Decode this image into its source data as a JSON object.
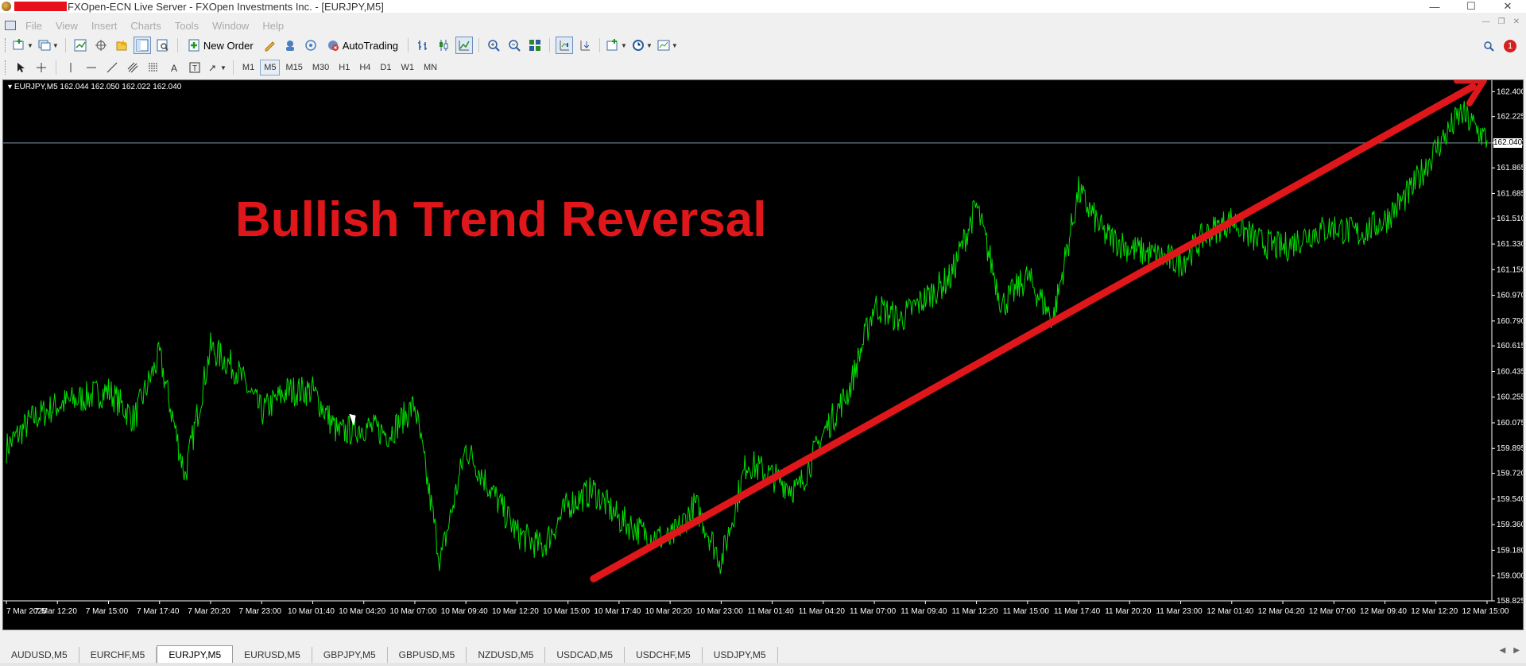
{
  "window": {
    "title": "FXOpen-ECN Live Server - FXOpen Investments Inc. - [EURJPY,M5]",
    "controls": {
      "minimize": "—",
      "maximize": "☐",
      "close": "✕"
    }
  },
  "menu": {
    "items": [
      "File",
      "View",
      "Insert",
      "Charts",
      "Tools",
      "Window",
      "Help"
    ],
    "mdi_controls": [
      "—",
      "❐",
      "✕"
    ]
  },
  "toolbar": {
    "new_order_label": "New Order",
    "autotrading_label": "AutoTrading",
    "notification_count": "1"
  },
  "timeframes": {
    "items": [
      "M1",
      "M5",
      "M15",
      "M30",
      "H1",
      "H4",
      "D1",
      "W1",
      "MN"
    ],
    "active": "M5"
  },
  "chart": {
    "symbol_info": "EURJPY,M5  162.044 162.050 162.022 162.040",
    "annotation_text": "Bullish Trend Reversal",
    "current_price_label": "162.040",
    "line_color": "#00e000",
    "arrow_color": "#e0171a",
    "annotation_color": "#e0171a",
    "background_color": "#000000"
  },
  "chart_data": {
    "type": "line",
    "title": "EURJPY,M5",
    "xlabel": "",
    "ylabel": "",
    "ylim": [
      158.825,
      162.48
    ],
    "y_ticks": [
      "162.400",
      "162.225",
      "162.040",
      "161.865",
      "161.685",
      "161.510",
      "161.330",
      "161.150",
      "160.970",
      "160.790",
      "160.615",
      "160.435",
      "160.255",
      "160.075",
      "159.895",
      "159.720",
      "159.540",
      "159.360",
      "159.180",
      "159.000",
      "158.825"
    ],
    "x_ticks": [
      "7 Mar 2025",
      "7 Mar 12:20",
      "7 Mar 15:00",
      "7 Mar 17:40",
      "7 Mar 20:20",
      "7 Mar 23:00",
      "10 Mar 01:40",
      "10 Mar 04:20",
      "10 Mar 07:00",
      "10 Mar 09:40",
      "10 Mar 12:20",
      "10 Mar 15:00",
      "10 Mar 17:40",
      "10 Mar 20:20",
      "10 Mar 23:00",
      "11 Mar 01:40",
      "11 Mar 04:20",
      "11 Mar 07:00",
      "11 Mar 09:40",
      "11 Mar 12:20",
      "11 Mar 15:00",
      "11 Mar 17:40",
      "11 Mar 20:20",
      "11 Mar 23:00",
      "12 Mar 01:40",
      "12 Mar 04:20",
      "12 Mar 07:00",
      "12 Mar 09:40",
      "12 Mar 12:20",
      "12 Mar 15:00"
    ],
    "current_price": 162.04,
    "series": [
      {
        "x_index": [
          0,
          0.5,
          1,
          1.5,
          2,
          2.5,
          3,
          3.5,
          4,
          4.5,
          5,
          5.5,
          6,
          6.5,
          7,
          7.5,
          8,
          8.5,
          9,
          9.5,
          10,
          10.5,
          11,
          11.5,
          12,
          12.5,
          13,
          13.5,
          14,
          14.5,
          15,
          15.5,
          16,
          16.5,
          17,
          17.5,
          18,
          18.5,
          19,
          19.5,
          20,
          20.5,
          21,
          21.5,
          22,
          22.5,
          23,
          23.5,
          24,
          24.5,
          25,
          25.5,
          26,
          26.5,
          27,
          27.5,
          28,
          28.5,
          29
        ],
        "values": [
          159.9,
          160.1,
          160.2,
          160.25,
          160.3,
          160.1,
          160.55,
          159.7,
          160.6,
          160.45,
          160.15,
          160.3,
          160.3,
          160.0,
          160.05,
          160.0,
          160.2,
          159.1,
          159.9,
          159.6,
          159.3,
          159.2,
          159.5,
          159.6,
          159.4,
          159.3,
          159.25,
          159.5,
          159.1,
          159.8,
          159.7,
          159.6,
          160.0,
          160.3,
          160.9,
          160.8,
          160.95,
          161.1,
          161.6,
          160.9,
          161.1,
          160.8,
          161.7,
          161.4,
          161.3,
          161.25,
          161.2,
          161.4,
          161.5,
          161.35,
          161.3,
          161.4,
          161.45,
          161.4,
          161.5,
          161.7,
          162.0,
          162.25,
          162.06
        ]
      }
    ],
    "annotations": [
      {
        "type": "arrow",
        "from": {
          "x_index": 11.5,
          "y": 158.98
        },
        "to": {
          "x_index": 29,
          "y": 162.48
        }
      },
      {
        "type": "text",
        "text": "Bullish Trend Reversal"
      }
    ],
    "grid": false
  },
  "tabs": {
    "items": [
      "AUDUSD,M5",
      "EURCHF,M5",
      "EURJPY,M5",
      "EURUSD,M5",
      "GBPJPY,M5",
      "GBPUSD,M5",
      "NZDUSD,M5",
      "USDCAD,M5",
      "USDCHF,M5",
      "USDJPY,M5"
    ],
    "active": "EURJPY,M5",
    "scroll_left": "◀",
    "scroll_right": "▶"
  }
}
